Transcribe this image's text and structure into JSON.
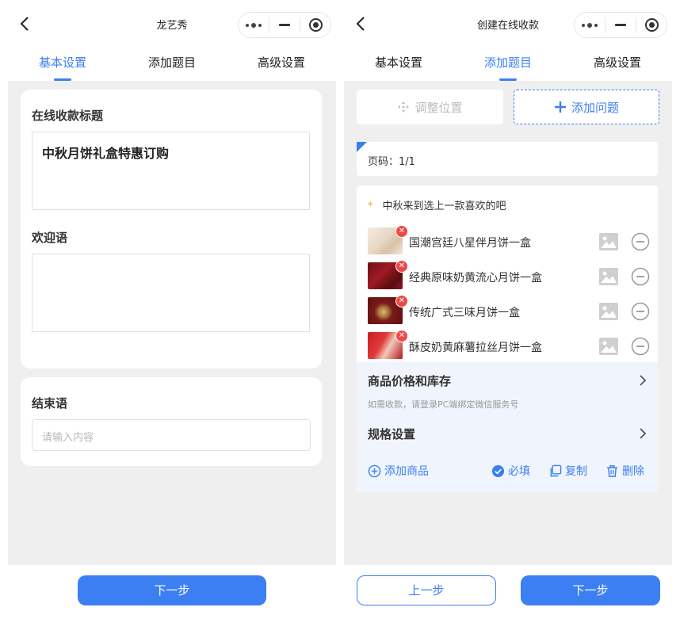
{
  "left": {
    "nav": {
      "title": "龙艺秀"
    },
    "tabs": [
      "基本设置",
      "添加题目",
      "高级设置"
    ],
    "form": {
      "title_label": "在线收款标题",
      "title_value": "中秋月饼礼盒特惠订购",
      "welcome_label": "欢迎语",
      "closing_label": "结束语",
      "closing_placeholder": "请输入内容"
    },
    "next_button": "下一步"
  },
  "right": {
    "nav": {
      "title": "创建在线收款"
    },
    "tabs": [
      "基本设置",
      "添加题目",
      "高级设置"
    ],
    "toolbar": {
      "adjust_label": "调整位置",
      "add_label": "添加问题"
    },
    "page_label": "页码：1/1",
    "question": {
      "required_mark": "*",
      "title": "中秋来到选上一款喜欢的吧",
      "options": [
        "国潮宫廷八星伴月饼一盒",
        "经典原味奶黄流心月饼一盒",
        "传统广式三味月饼一盒",
        "酥皮奶黄麻薯拉丝月饼一盒"
      ]
    },
    "price_row": "商品价格和库存",
    "price_hint": "如需收款，请登录PC端绑定微信服务号",
    "spec_row": "规格设置",
    "actions": {
      "add_product": "添加商品",
      "required": "必填",
      "copy": "复制",
      "delete": "删除"
    },
    "prev_button": "上一步",
    "next_button": "下一步"
  },
  "colors": {
    "accent": "#3b7ff3",
    "delete": "#f04848",
    "required_star": "#f5a623",
    "background": "#efefef"
  },
  "icons": [
    "back-arrow-icon",
    "more-dots-icon",
    "minimize-icon",
    "record-icon",
    "move-icon",
    "plus-icon",
    "image-icon",
    "remove-circle-icon",
    "chevron-right-icon",
    "plus-circle-icon",
    "check-circle-icon",
    "copy-icon",
    "trash-icon"
  ]
}
